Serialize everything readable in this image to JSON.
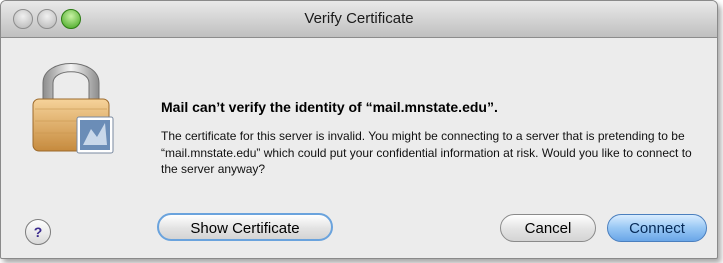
{
  "window": {
    "title": "Verify Certificate"
  },
  "dialog": {
    "headline": "Mail can’t verify the identity of “mail.mnstate.edu”.",
    "body": "The certificate for this server is invalid. You might be connecting to a server that is pretending to be “mail.mnstate.edu” which could put your confidential information at risk. Would you like to connect to the server anyway?"
  },
  "buttons": {
    "help": "?",
    "show_certificate": "Show Certificate",
    "cancel": "Cancel",
    "connect": "Connect"
  },
  "colors": {
    "accent": "#6aa6e8",
    "zoom_button": "#3fa31c",
    "window_bg": "#ececec"
  }
}
